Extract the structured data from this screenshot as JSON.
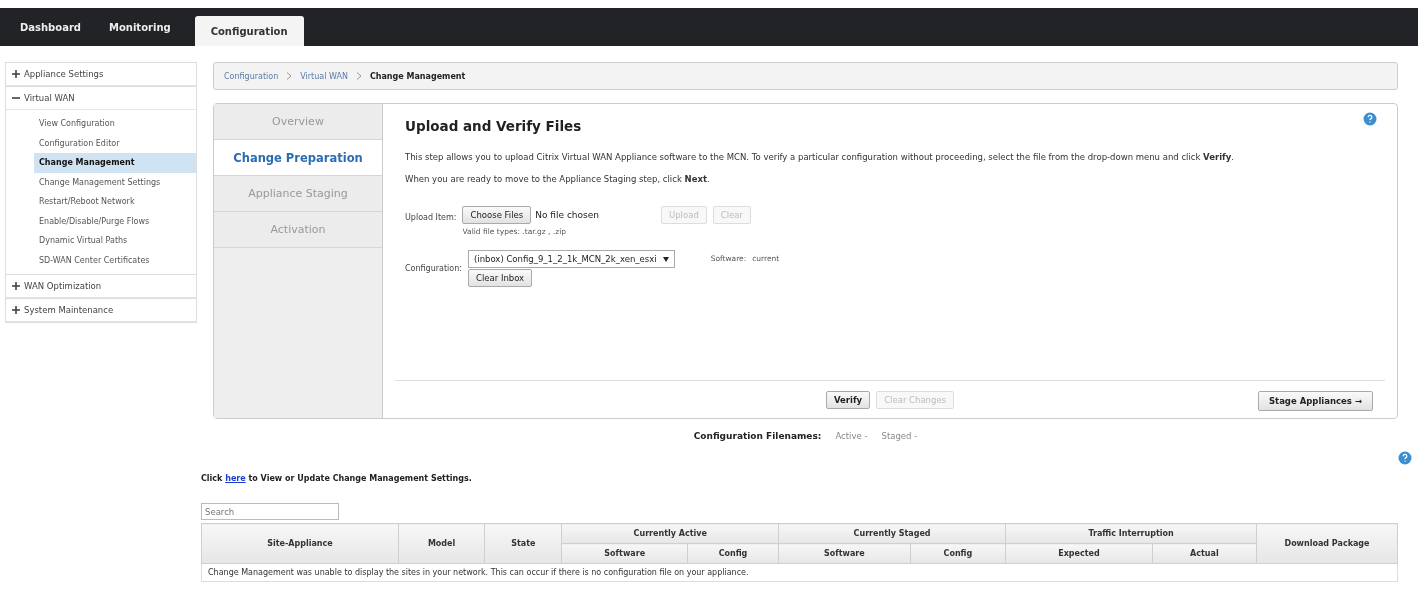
{
  "nav_tabs": [
    {
      "label": "Dashboard",
      "selected": false
    },
    {
      "label": "Monitoring",
      "selected": false
    },
    {
      "label": "Configuration",
      "selected": true
    }
  ],
  "sidebar": {
    "items": [
      {
        "label": "Appliance Settings",
        "expanded": false
      },
      {
        "label": "Virtual WAN",
        "expanded": true,
        "children": [
          {
            "label": "View Configuration",
            "selected": false
          },
          {
            "label": "Configuration Editor",
            "selected": false
          },
          {
            "label": "Change Management",
            "selected": true
          },
          {
            "label": "Change Management Settings",
            "selected": false
          },
          {
            "label": "Restart/Reboot Network",
            "selected": false
          },
          {
            "label": "Enable/Disable/Purge Flows",
            "selected": false
          },
          {
            "label": "Dynamic Virtual Paths",
            "selected": false
          },
          {
            "label": "SD-WAN Center Certificates",
            "selected": false
          }
        ]
      },
      {
        "label": "WAN Optimization",
        "expanded": false
      },
      {
        "label": "System Maintenance",
        "expanded": false
      }
    ]
  },
  "breadcrumb": [
    "Configuration",
    "Virtual WAN",
    "Change Management"
  ],
  "steps": [
    {
      "label": "Overview",
      "selected": false
    },
    {
      "label": "Change Preparation",
      "selected": true
    },
    {
      "label": "Appliance Staging",
      "selected": false
    },
    {
      "label": "Activation",
      "selected": false
    }
  ],
  "panel": {
    "title": "Upload and Verify Files",
    "paragraphs": [
      "This step allows you to upload Citrix Virtual WAN Appliance software to the MCN. To verify a particular configuration without proceeding, select the file from the drop-down menu and click **Verify**.",
      "When you are ready to move to the Appliance Staging step, click **Next**."
    ],
    "upload_label": "Upload Item:",
    "choose_button": "Choose Files",
    "no_file": "No file chosen",
    "valid_types": "Valid file types: .tar.gz , .zip",
    "upload_buttons": [
      {
        "label": "Upload",
        "disabled": true
      },
      {
        "label": "Clear",
        "disabled": true
      }
    ],
    "configuration_label": "Configuration:",
    "configuration_value": "(inbox) Config_9_1_2_1k_MCN_2k_xen_esxi",
    "clear_inbox": "Clear Inbox",
    "software_label": "Software:",
    "software_value": "current",
    "footer_buttons": [
      {
        "label": "Verify",
        "disabled": false
      },
      {
        "label": "Clear Changes",
        "disabled": true
      }
    ],
    "stage_button": "Stage Appliances →"
  },
  "filenames": {
    "label": "Configuration Filenames:",
    "active": "Active -",
    "staged": "Staged -"
  },
  "settings_link": {
    "before": "Click",
    "link": "here",
    "after": "to View or Update Change Management Settings."
  },
  "search": {
    "placeholder": "Search"
  },
  "table": {
    "groups": [
      {
        "label": "Site-Appliance"
      },
      {
        "label": "Model"
      },
      {
        "label": "State"
      },
      {
        "label": "Currently Active",
        "columns": [
          "Software",
          "Config"
        ]
      },
      {
        "label": "Currently Staged",
        "columns": [
          "Software",
          "Config"
        ]
      },
      {
        "label": "Traffic Interruption",
        "columns": [
          "Expected",
          "Actual"
        ]
      },
      {
        "label": "Download Package"
      }
    ],
    "message": "Change Management was unable to display the sites in your network. This can occur if there is no configuration file on your appliance."
  }
}
